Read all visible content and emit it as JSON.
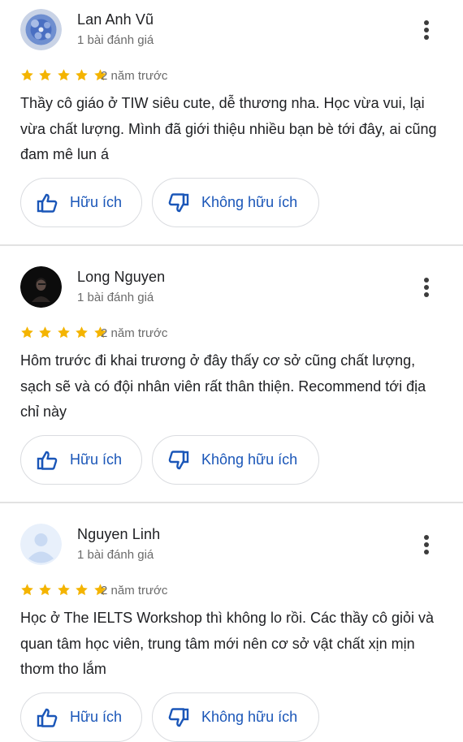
{
  "colors": {
    "star": "#f4b400",
    "link_blue": "#1a56b8",
    "divider": "#e2e2e2"
  },
  "reviews": [
    {
      "name": "Lan Anh Vũ",
      "review_count": "1 bài đánh giá",
      "rating": 5,
      "time": "2 năm trước",
      "text": "Thầy cô giáo ở TIW siêu cute, dễ thương nha. Học vừa vui, lại vừa chất lượng. Mình đã giới thiệu nhiều bạn bè tới đây, ai cũng đam mê lun á",
      "helpful_label": "Hữu ích",
      "not_helpful_label": "Không hữu ích",
      "avatar": "blue-flower-photo"
    },
    {
      "name": "Long Nguyen",
      "review_count": "1 bài đánh giá",
      "rating": 5,
      "time": "2 năm trước",
      "text": "Hôm trước đi khai trương ở đây thấy cơ sở cũng chất lượng, sạch sẽ và có đội nhân viên rất thân thiện. Recommend tới địa chỉ này",
      "helpful_label": "Hữu ích",
      "not_helpful_label": "Không hữu ích",
      "avatar": "dark-portrait-photo"
    },
    {
      "name": "Nguyen Linh",
      "review_count": "1 bài đánh giá",
      "rating": 5,
      "time": "2 năm trước",
      "text": "Học ở The IELTS Workshop thì không lo rồi. Các thầy cô giỏi và quan tâm học viên, trung tâm mới nên cơ sở vật chất xịn mịn thơm tho lắm",
      "helpful_label": "Hữu ích",
      "not_helpful_label": "Không hữu ích",
      "avatar": "default-user-placeholder"
    }
  ]
}
